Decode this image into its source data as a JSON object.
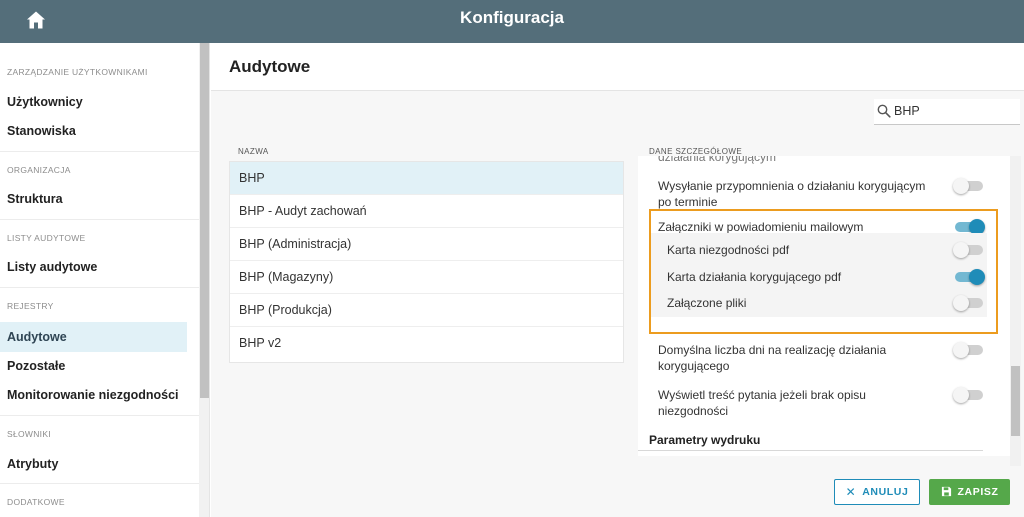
{
  "header": {
    "title": "Konfiguracja",
    "home_icon": "home-icon"
  },
  "sidebar": {
    "sections": [
      {
        "label": "ZARZĄDZANIE UŻYTKOWNIKAMI",
        "items": [
          "Użytkownicy",
          "Stanowiska"
        ]
      },
      {
        "label": "ORGANIZACJA",
        "items": [
          "Struktura"
        ]
      },
      {
        "label": "LISTY AUDYTOWE",
        "items": [
          "Listy audytowe"
        ]
      },
      {
        "label": "REJESTRY",
        "items": [
          "Audytowe",
          "Pozostałe",
          "Monitorowanie niezgodności"
        ]
      },
      {
        "label": "SŁOWNIKI",
        "items": [
          "Atrybuty"
        ]
      },
      {
        "label": "DODATKOWE",
        "items": []
      }
    ],
    "active_item": "Audytowe"
  },
  "page": {
    "title": "Audytowe"
  },
  "search": {
    "value": "BHP",
    "icon": "search-icon"
  },
  "list": {
    "header": "NAZWA",
    "items": [
      "BHP",
      "BHP - Audyt zachowań",
      "BHP (Administracja)",
      "BHP (Magazyny)",
      "BHP (Produkcja)",
      "BHP v2"
    ],
    "selected_index": 0
  },
  "details": {
    "header": "DANE SZCZEGÓŁOWE",
    "clipped_text": "działania korygującym",
    "settings": [
      {
        "label": "Wysyłanie przypomnienia o działaniu korygującym po terminie",
        "on": false
      },
      {
        "label": "Załączniki w powiadomieniu mailowym",
        "on": true
      },
      {
        "label": "Karta niezgodności pdf",
        "on": false
      },
      {
        "label": "Karta działania korygującego pdf",
        "on": true
      },
      {
        "label": "Załączone pliki",
        "on": false
      },
      {
        "label": "Domyślna liczba dni na realizację działania korygującego",
        "on": false
      },
      {
        "label": "Wyświetl treść pytania jeżeli brak opisu niezgodności",
        "on": false
      }
    ],
    "print_section": "Parametry wydruku"
  },
  "actions": {
    "cancel": "ANULUJ",
    "save": "ZAPISZ"
  },
  "colors": {
    "header_bg": "#546e7a",
    "accent": "#1f8cb8",
    "save_bg": "#55a84a",
    "highlight": "#ec9c1f",
    "selected_bg": "#e1f1f7"
  }
}
